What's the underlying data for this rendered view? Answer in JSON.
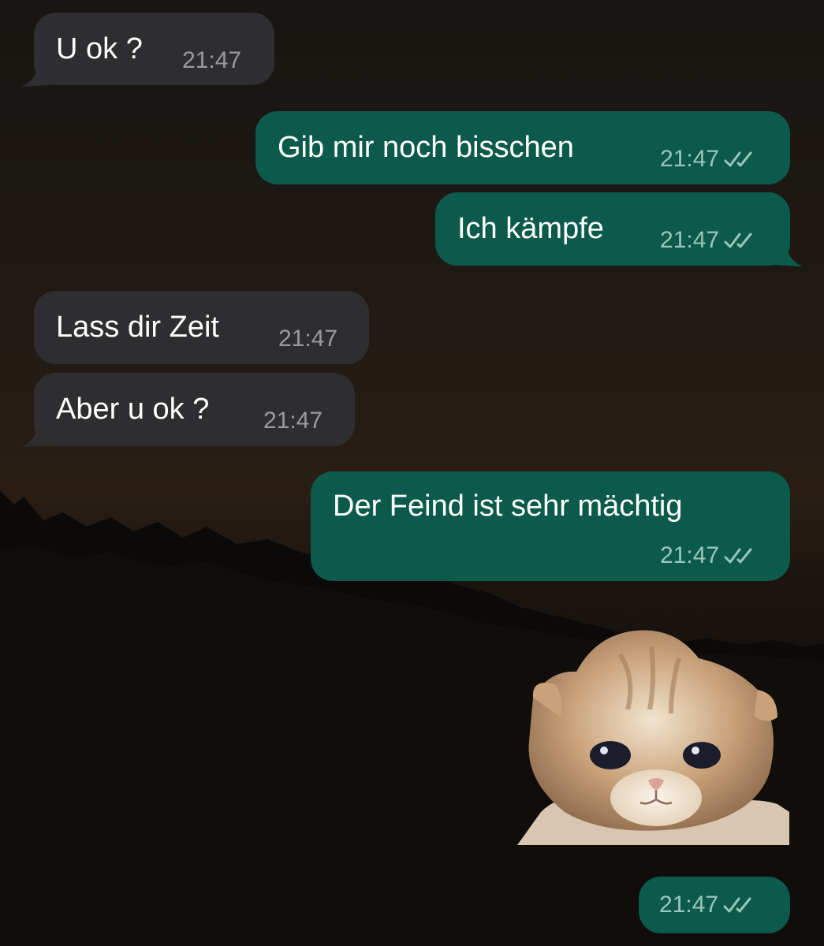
{
  "chat": {
    "messages": [
      {
        "direction": "incoming",
        "text": "U ok ?",
        "time": "21:47"
      },
      {
        "direction": "outgoing",
        "text": "Gib mir noch bisschen",
        "time": "21:47",
        "status_icon": "double-check-icon"
      },
      {
        "direction": "outgoing",
        "text": "Ich kämpfe",
        "time": "21:47",
        "status_icon": "double-check-icon"
      },
      {
        "direction": "incoming",
        "text": "Lass dir Zeit",
        "time": "21:47"
      },
      {
        "direction": "incoming",
        "text": "Aber u ok ?",
        "time": "21:47"
      },
      {
        "direction": "outgoing",
        "text": "Der Feind ist sehr mächtig",
        "time": "21:47",
        "status_icon": "double-check-icon"
      },
      {
        "direction": "outgoing",
        "sticker": "crying-kitten-sticker"
      },
      {
        "direction": "outgoing",
        "time": "21:47",
        "status_icon": "double-check-icon"
      }
    ]
  },
  "colors": {
    "incoming_bubble": "#2e2e30",
    "outgoing_bubble": "#0b5a4c",
    "text": "#ffffff",
    "incoming_time": "#9b9b9f",
    "outgoing_time": "#9bc5bb"
  },
  "wallpaper": "dusk-forest-silhouette"
}
